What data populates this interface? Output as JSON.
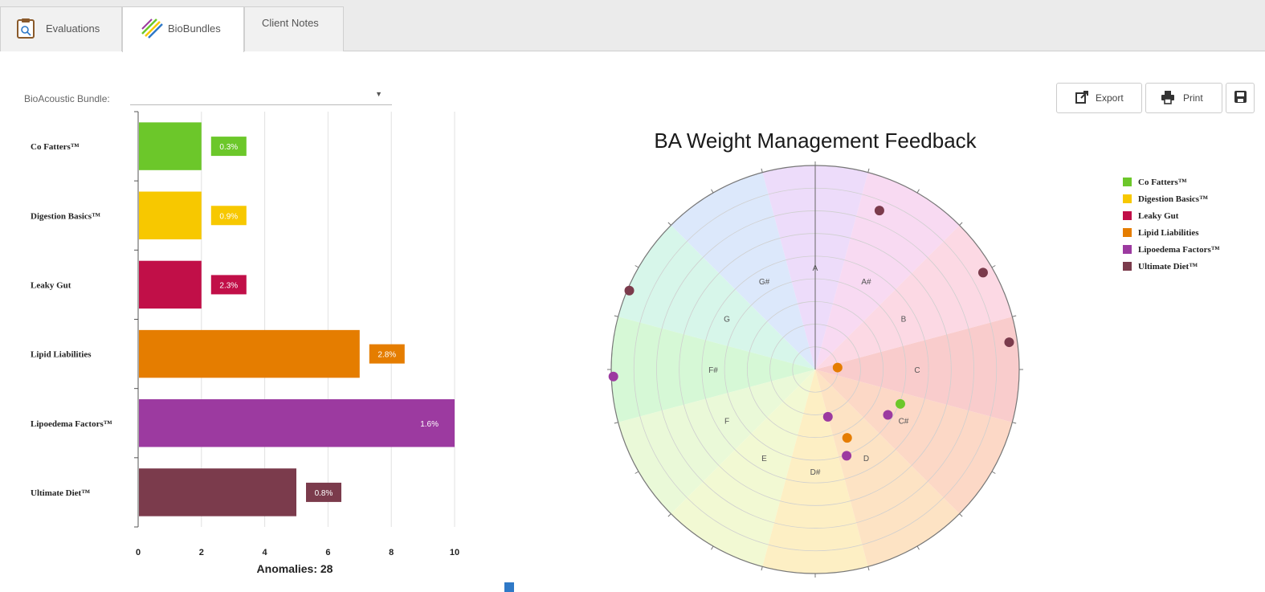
{
  "tabs": [
    {
      "label": "Evaluations",
      "icon": "clipboard-icon"
    },
    {
      "label": "BioBundles",
      "icon": "biobundle-icon"
    },
    {
      "label": "Client Notes"
    }
  ],
  "bundle_selector": {
    "label": "BioAcoustic Bundle:",
    "value": ""
  },
  "toolbar": {
    "export_label": "Export",
    "print_label": "Print",
    "save_icon": "save-icon"
  },
  "colors": {
    "Co Fatters™": "#6cc72a",
    "Digestion Basics™": "#f7c800",
    "Leaky Gut": "#c10f48",
    "Lipid Liabilities": "#e57d00",
    "Lipoedema Factors™": "#9c3aa0",
    "Ultimate Diet™": "#7b3b4c"
  },
  "chart_data": [
    {
      "type": "bar",
      "orientation": "horizontal",
      "categories": [
        "Co Fatters™",
        "Digestion Basics™",
        "Leaky Gut",
        "Lipid Liabilities",
        "Lipoedema Factors™",
        "Ultimate Diet™"
      ],
      "values": [
        2,
        2,
        2,
        7,
        10,
        5
      ],
      "data_labels": [
        "0.3%",
        "0.9%",
        "2.3%",
        "2.8%",
        "1.6%",
        "0.8%"
      ],
      "xlim": [
        0,
        10
      ],
      "xticks": [
        "0",
        "2",
        "4",
        "6",
        "8",
        "10"
      ],
      "xlabel": "Anomalies: 28",
      "grid": true
    },
    {
      "type": "scatter",
      "coordinate_system": "polar",
      "title": "BA Weight Management Feedback",
      "sectors": [
        "A",
        "G#",
        "G",
        "F#",
        "F",
        "E",
        "D#",
        "D",
        "C#",
        "C",
        "B",
        "A#"
      ],
      "sector_colors": [
        "#eddcfa",
        "#dce8fb",
        "#d7f6ea",
        "#d6f8d6",
        "#eaf9d8",
        "#f2f9d3",
        "#fdefc4",
        "#fde3c4",
        "#fcd8c6",
        "#f9cccc",
        "#fcd9e4",
        "#f8daf2"
      ],
      "rmax": 100,
      "legend": "right",
      "series": [
        {
          "name": "Co Fatters™",
          "points": [
            {
              "angle": 112,
              "r": 45
            }
          ]
        },
        {
          "name": "Lipid Liabilities",
          "points": [
            {
              "angle": 85,
              "r": 11
            },
            {
              "angle": 155,
              "r": 37
            }
          ]
        },
        {
          "name": "Lipoedema Factors™",
          "points": [
            {
              "angle": 165,
              "r": 24
            },
            {
              "angle": 122,
              "r": 42
            },
            {
              "angle": 160,
              "r": 45
            },
            {
              "angle": 268,
              "r": 99
            }
          ]
        },
        {
          "name": "Ultimate Diet™",
          "points": [
            {
              "angle": 22,
              "r": 84
            },
            {
              "angle": 60,
              "r": 95
            },
            {
              "angle": 82,
              "r": 96
            },
            {
              "angle": 293,
              "r": 99
            }
          ]
        }
      ]
    }
  ]
}
